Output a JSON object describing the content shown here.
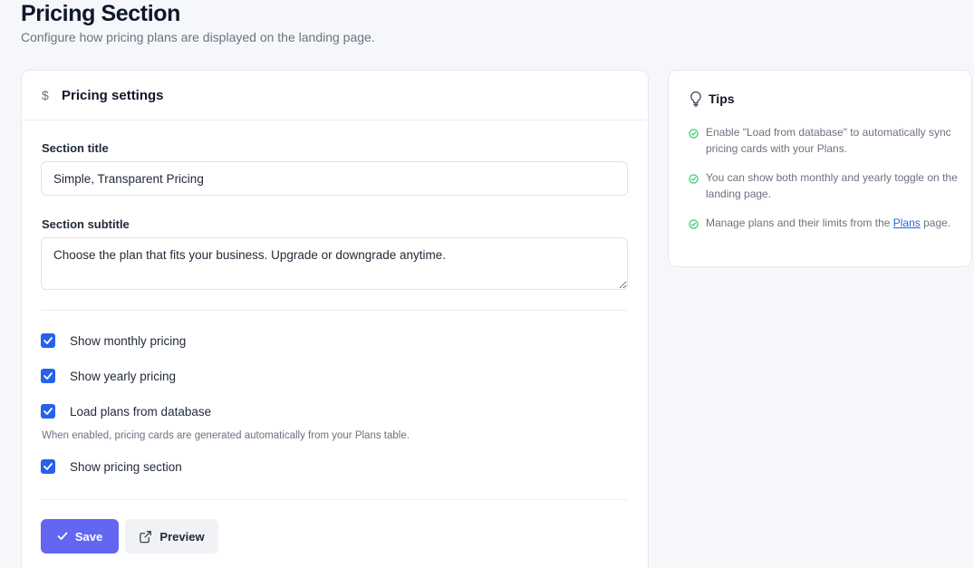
{
  "header": {
    "title": "Pricing Section",
    "subtitle": "Configure how pricing plans are displayed on the landing page."
  },
  "settings_card": {
    "title": "Pricing settings",
    "icon": "dollar-icon",
    "section_title": {
      "label": "Section title",
      "value": "Simple, Transparent Pricing"
    },
    "section_subtitle": {
      "label": "Section subtitle",
      "value": "Choose the plan that fits your business. Upgrade or downgrade anytime."
    },
    "checkboxes": [
      {
        "label": "Show monthly pricing",
        "checked": true
      },
      {
        "label": "Show yearly pricing",
        "checked": true
      },
      {
        "label": "Load plans from database",
        "checked": true
      },
      {
        "label": "Show pricing section",
        "checked": true
      }
    ],
    "database_help": "When enabled, pricing cards are generated automatically from your Plans table.",
    "save_label": "Save",
    "preview_label": "Preview"
  },
  "tips": {
    "title": "Tips",
    "items": [
      {
        "text": "Enable \"Load from database\" to automatically sync pricing cards with your Plans."
      },
      {
        "text": "You can show both monthly and yearly toggle on the landing page."
      },
      {
        "text_before": "Manage plans and their limits from the ",
        "link": "Plans",
        "text_after": " page."
      }
    ]
  },
  "colors": {
    "primary": "#6366f1",
    "checkbox": "#2563eb",
    "tip_check": "#22c55e",
    "link": "#2563eb"
  }
}
